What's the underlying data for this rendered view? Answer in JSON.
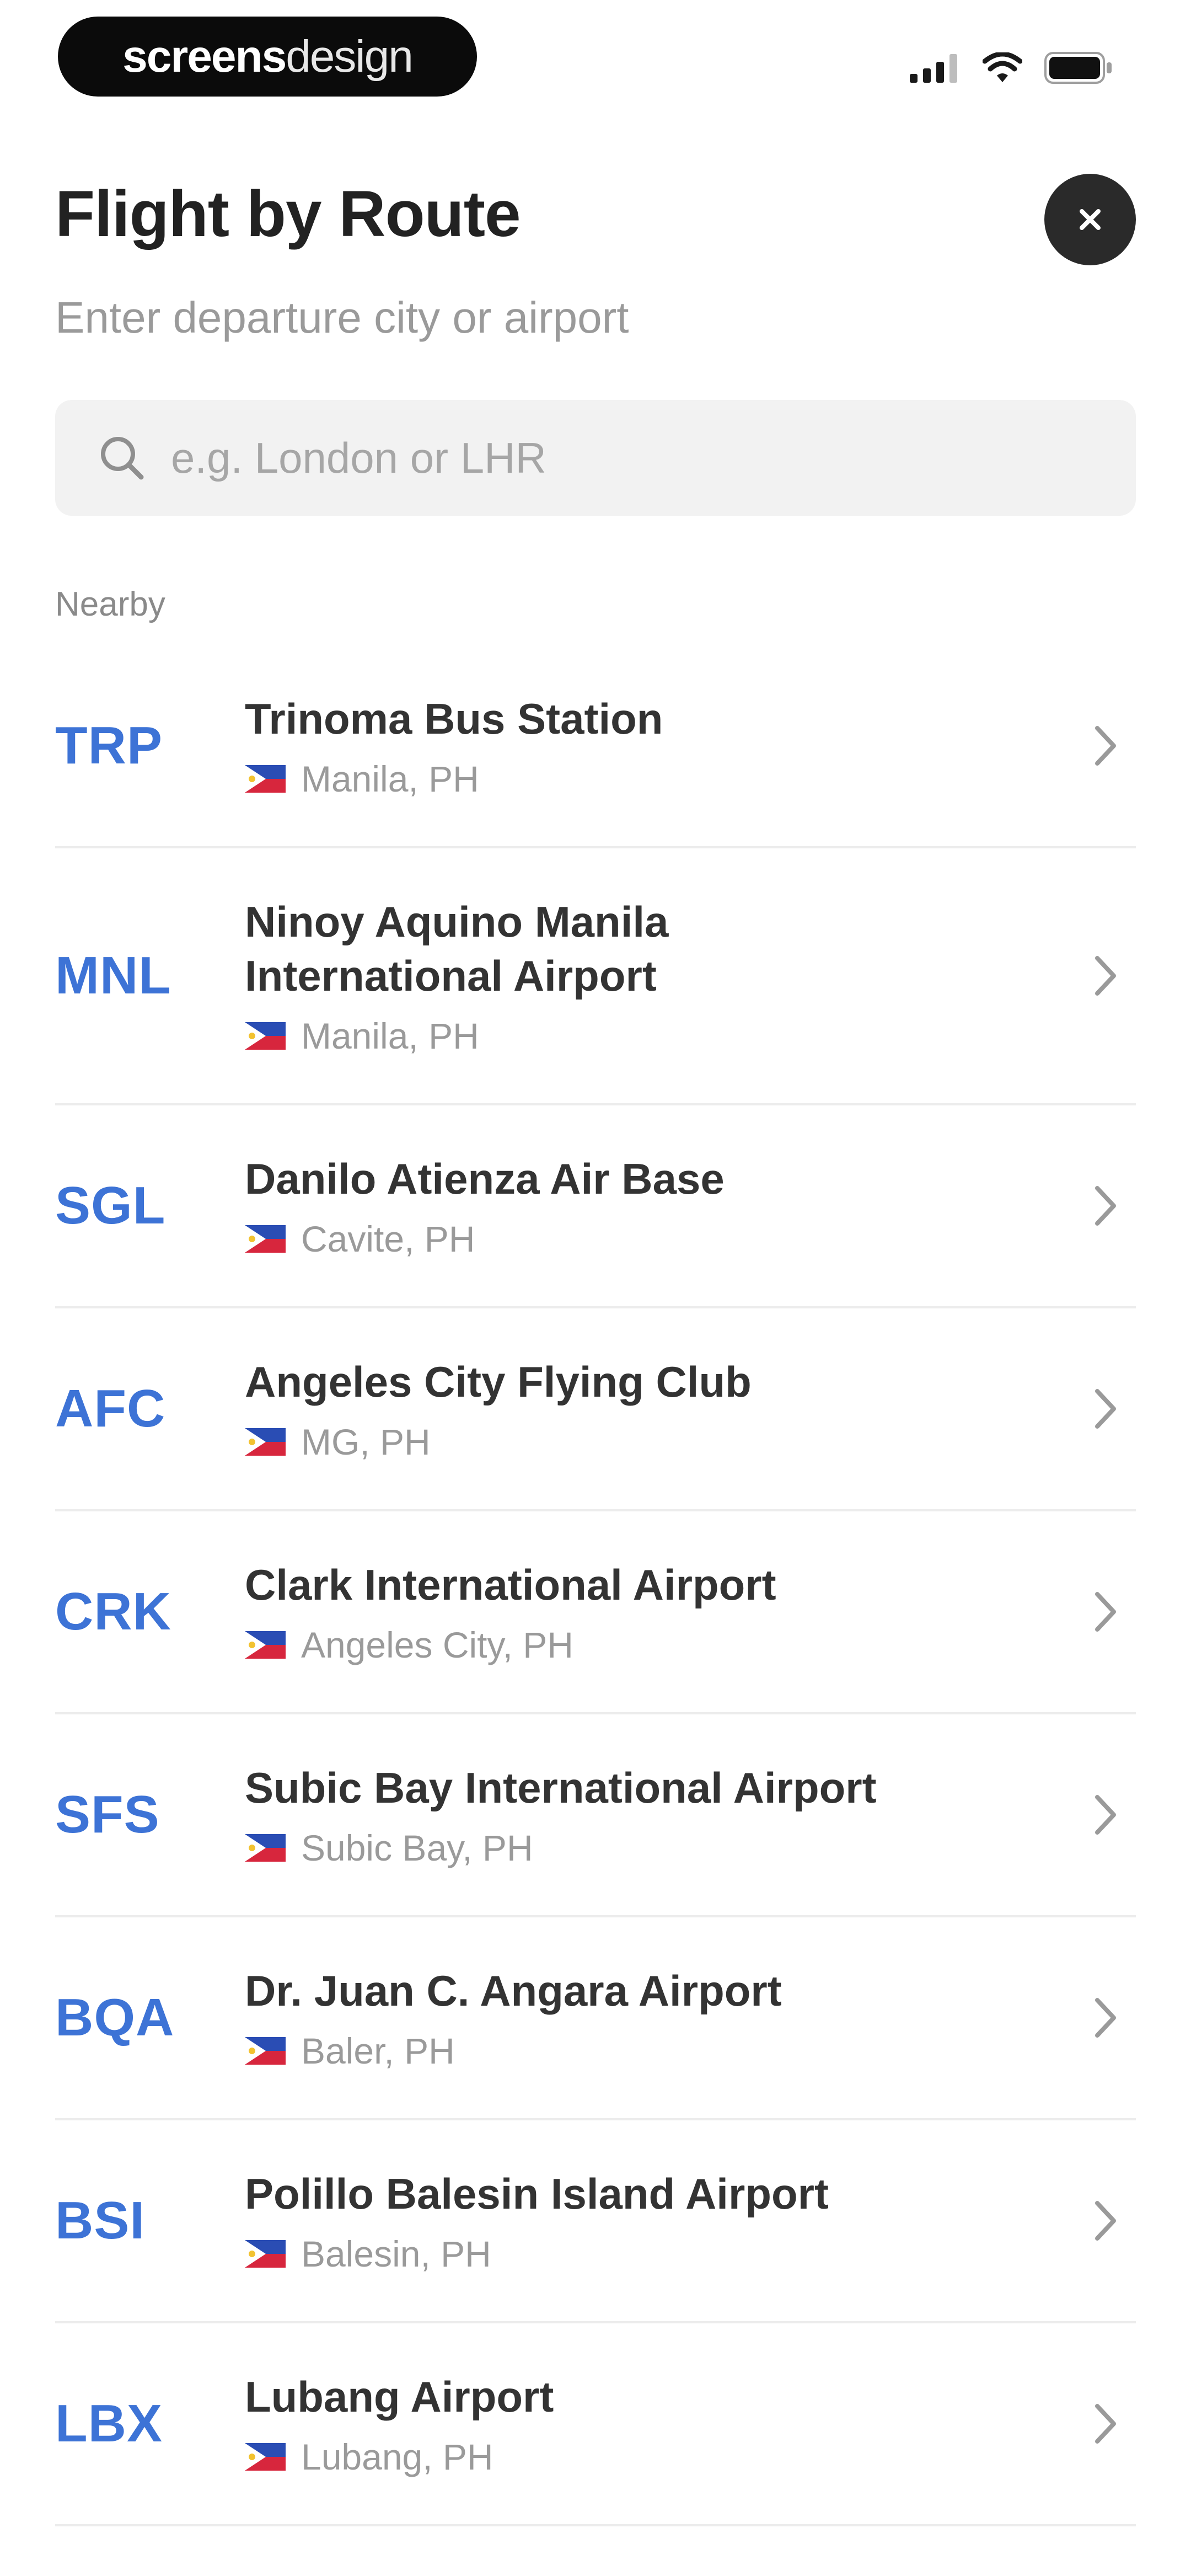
{
  "status_bar": {
    "brand_bold": "screens",
    "brand_light": "design"
  },
  "header": {
    "title": "Flight by Route",
    "subtitle": "Enter departure city or airport"
  },
  "search": {
    "placeholder": "e.g. London or LHR",
    "value": ""
  },
  "section": {
    "label": "Nearby"
  },
  "airports": [
    {
      "code": "TRP",
      "name": "Trinoma Bus Station",
      "location": "Manila, PH"
    },
    {
      "code": "MNL",
      "name": "Ninoy Aquino Manila International Airport",
      "location": "Manila, PH"
    },
    {
      "code": "SGL",
      "name": "Danilo Atienza Air Base",
      "location": "Cavite, PH"
    },
    {
      "code": "AFC",
      "name": "Angeles City Flying Club",
      "location": "MG, PH"
    },
    {
      "code": "CRK",
      "name": "Clark International Airport",
      "location": "Angeles City, PH"
    },
    {
      "code": "SFS",
      "name": "Subic Bay International Airport",
      "location": "Subic Bay, PH"
    },
    {
      "code": "BQA",
      "name": "Dr. Juan C. Angara Airport",
      "location": "Baler, PH"
    },
    {
      "code": "BSI",
      "name": "Polillo Balesin Island Airport",
      "location": "Balesin, PH"
    },
    {
      "code": "LBX",
      "name": "Lubang Airport",
      "location": "Lubang, PH"
    }
  ],
  "icons": {
    "close": "close-icon",
    "search": "search-icon",
    "chevron": "chevron-right-icon",
    "flag": "philippines-flag-icon"
  },
  "colors": {
    "accent": "#3d73d6",
    "close_bg": "#2a2a2a",
    "search_bg": "#f2f2f2"
  }
}
